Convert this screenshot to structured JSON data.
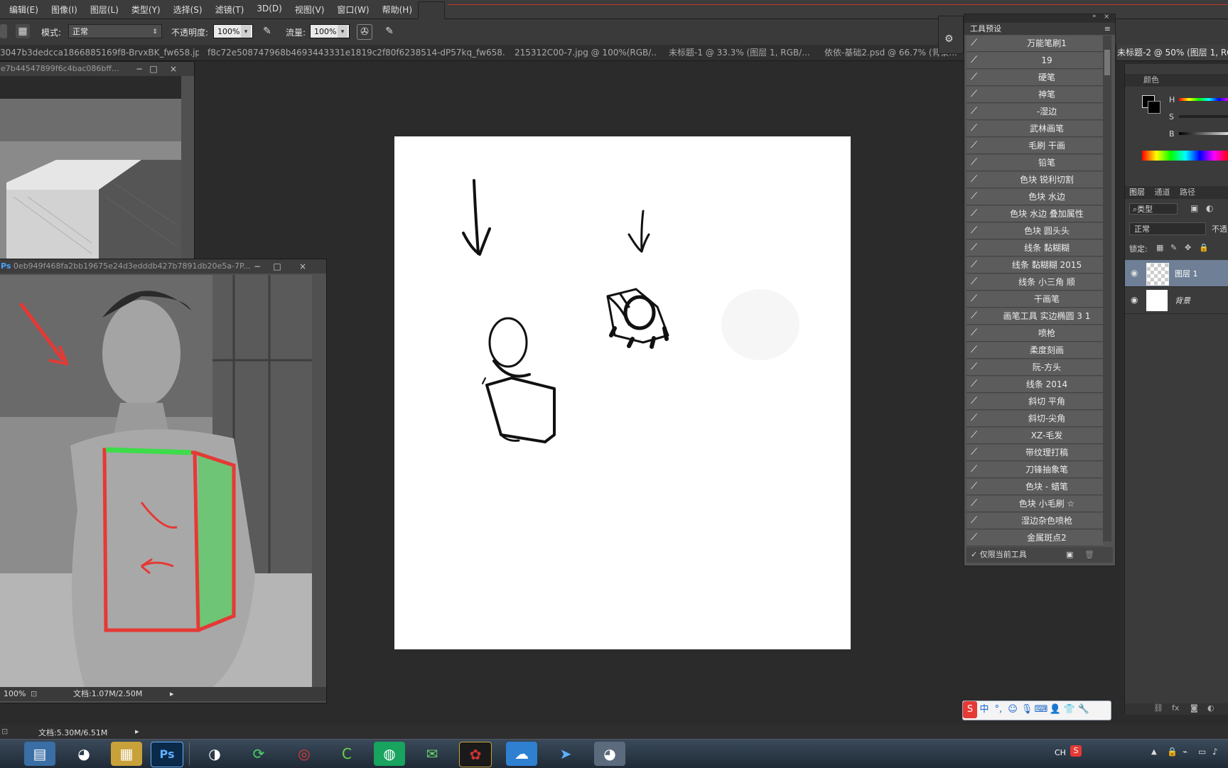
{
  "menu": {
    "items": [
      "编辑(E)",
      "图像(I)",
      "图层(L)",
      "类型(Y)",
      "选择(S)",
      "滤镜(T)",
      "3D(D)",
      "视图(V)",
      "窗口(W)",
      "帮助(H)"
    ]
  },
  "options": {
    "mode_label": "模式:",
    "mode_value": "正常",
    "opacity_label": "不透明度:",
    "opacity_value": "100%",
    "flow_label": "流量:",
    "flow_value": "100%"
  },
  "tabs": [
    "3047b3dedcca1866885169f8-BrvxBK_fw658.jpg",
    "f8c72e508747968b4693443331e1819c2f80f6238514-dP57kq_fw658.jpg",
    "215312C00-7.jpg @ 100%(RGB/...",
    "未标题-1 @ 33.3% (图层 1, RGB/...",
    "依依-基础2.psd @ 66.7% (背景...",
    "未标题-2 @ 50% (图层 1, RG"
  ],
  "windows": {
    "cube_title": "e7b44547899f6c4bac086bff...",
    "photo_title": "0eb949f468fa2bb19675e24d3edddb427b7891db20e5a-7P...",
    "photo_zoom": "100%",
    "photo_doc": "文档:1.07M/2.50M"
  },
  "brush_panel": {
    "title": "工具预设",
    "presets": [
      "万能笔刷1",
      "19",
      "硬笔",
      "神笔",
      "-湿边",
      "武林画笔",
      "毛刷 干画",
      "铅笔",
      "色块 锐利切割",
      "色块 水边",
      "色块 水边 叠加属性",
      "色块 圆头头",
      "线条 黏糊糊",
      "线条 黏糊糊 2015",
      "线条 小三角 顺",
      "干画笔",
      "画笔工具 实边椭圆 3 1",
      "喷枪",
      "柔度刻画",
      "阮-方头",
      "线条 2014",
      "斜切 平角",
      "斜切-尖角",
      "XZ-毛发",
      "带纹理打稿",
      "刀锋抽象笔",
      "色块 - 蜡笔",
      "色块 小毛刷 ☆",
      "湿边杂色喷枪",
      "金属斑点2"
    ],
    "footer_checkbox": "仅限当前工具"
  },
  "color_panel": {
    "title": "颜色",
    "h": "H",
    "s": "S",
    "b": "B"
  },
  "layers_panel": {
    "tabs": [
      "图层",
      "通道",
      "路径"
    ],
    "filter": "类型",
    "blend": "正常",
    "opacity_short": "不透",
    "lock_label": "锁定:",
    "layers": [
      "图层 1",
      "背景"
    ]
  },
  "status": {
    "doc": "文档:5.30M/6.51M",
    "sys_lang": "CH"
  },
  "ime": [
    "中",
    "°,",
    "☺",
    "🎙",
    "⌨",
    "👤",
    "👕",
    "🔧"
  ],
  "colors": {
    "accent_red": "#e53935",
    "accent_green": "#3ddc4a",
    "selected_layer": "#6f7f96"
  }
}
